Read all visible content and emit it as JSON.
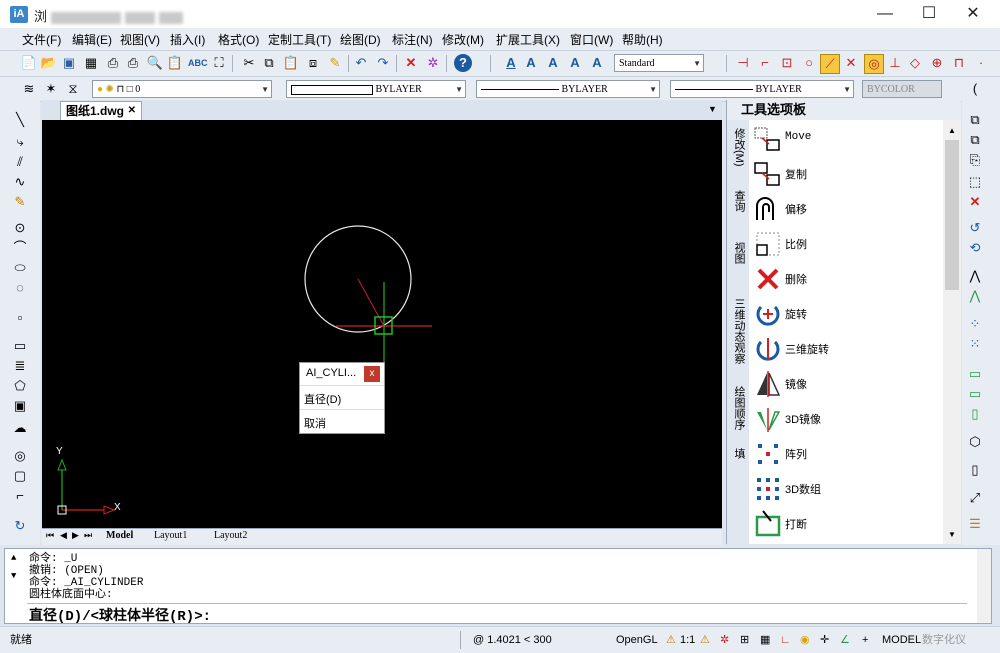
{
  "window": {
    "title": "浏",
    "minimize": "—",
    "maximize": "☐",
    "close": "✕"
  },
  "menu": [
    "文件(F)",
    "编辑(E)",
    "视图(V)",
    "插入(I)",
    "格式(O)",
    "定制工具(T)",
    "绘图(D)",
    "标注(N)",
    "修改(M)",
    "扩展工具(X)",
    "窗口(W)",
    "帮助(H)"
  ],
  "toolbar": {
    "text_style": "Standard",
    "layer": "0",
    "linetype": "BYLAYER",
    "lineweight": "BYLAYER",
    "color_layer": "BYLAYER",
    "plot_style": "BYCOLOR"
  },
  "document": {
    "tab": "图纸1.dwg",
    "tab_close": "✕"
  },
  "layouts": [
    "Model",
    "Layout1",
    "Layout2"
  ],
  "ucs": {
    "x_label": "X",
    "y_label": "Y"
  },
  "popup": {
    "title": "AI_CYLI...",
    "close": "x",
    "items": [
      "直径(D)",
      "取消"
    ]
  },
  "palette": {
    "title": "工具选项板",
    "tabs": [
      "修改(M)",
      "查询",
      "视图",
      "三维动态观察",
      "绘图顺序",
      "填"
    ],
    "items": [
      {
        "label": "Move",
        "icon": "move-icon"
      },
      {
        "label": "复制",
        "icon": "copy-icon"
      },
      {
        "label": "偏移",
        "icon": "offset-icon"
      },
      {
        "label": "比例",
        "icon": "scale-icon"
      },
      {
        "label": "删除",
        "icon": "erase-icon"
      },
      {
        "label": "旋转",
        "icon": "rotate-icon"
      },
      {
        "label": "三维旋转",
        "icon": "rotate3d-icon"
      },
      {
        "label": "镜像",
        "icon": "mirror-icon"
      },
      {
        "label": "3D镜像",
        "icon": "mirror3d-icon"
      },
      {
        "label": "阵列",
        "icon": "array-icon"
      },
      {
        "label": "3D数组",
        "icon": "array3d-icon"
      },
      {
        "label": "打断",
        "icon": "break-icon"
      }
    ]
  },
  "command": {
    "history": [
      "命令:  _U",
      "撤销: (OPEN)",
      "命令:  _AI_CYLINDER",
      "圆柱体底面中心:"
    ],
    "prompt": "直径(D)/<球柱体半径(R)>:"
  },
  "status": {
    "ready": "就绪",
    "coords": "@ 1.4021 < 300",
    "renderer": "OpenGL",
    "scale": "1:1",
    "model": "MODEL",
    "digitizer": "数字化仪"
  }
}
